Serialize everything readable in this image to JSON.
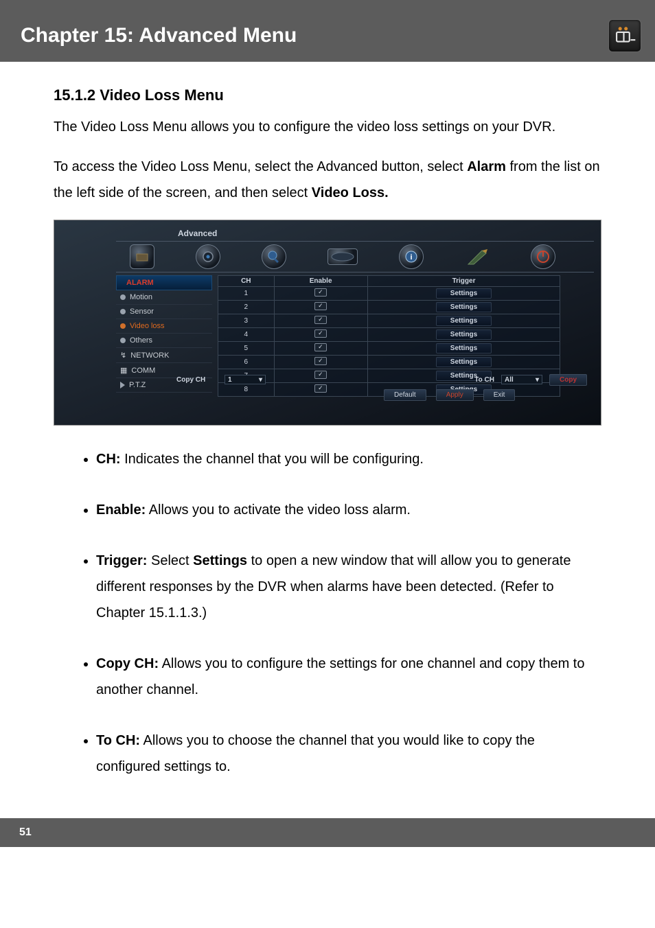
{
  "header": {
    "chapter_title": "Chapter 15: Advanced Menu"
  },
  "section": {
    "heading": "15.1.2 Video Loss Menu",
    "intro": "The Video Loss Menu allows you to configure the video loss settings on your DVR.",
    "access_pre": "To access the Video Loss Menu, select the Advanced button, select ",
    "access_b1": "Alarm",
    "access_mid": " from the list on the left side of the screen, and then select ",
    "access_b2": "Video Loss."
  },
  "shot": {
    "window_title": "Advanced",
    "sidebar_header": "ALARM",
    "sidebar": [
      "Motion",
      "Sensor",
      "Video loss",
      "Others",
      "NETWORK",
      "COMM",
      "P.T.Z"
    ],
    "columns": {
      "ch": "CH",
      "enable": "Enable",
      "trigger": "Trigger"
    },
    "rows": [
      {
        "ch": "1",
        "trigger": "Settings"
      },
      {
        "ch": "2",
        "trigger": "Settings"
      },
      {
        "ch": "3",
        "trigger": "Settings"
      },
      {
        "ch": "4",
        "trigger": "Settings"
      },
      {
        "ch": "5",
        "trigger": "Settings"
      },
      {
        "ch": "6",
        "trigger": "Settings"
      },
      {
        "ch": "7",
        "trigger": "Settings"
      },
      {
        "ch": "8",
        "trigger": "Settings"
      }
    ],
    "copy_label": "Copy CH",
    "copy_value": "1",
    "toch_label": "To CH",
    "toch_value": "All",
    "btn_copy": "Copy",
    "btn_default": "Default",
    "btn_apply": "Apply",
    "btn_exit": "Exit"
  },
  "bullets": {
    "ch_l": "CH:",
    "ch_t": " Indicates the channel that you will be configuring.",
    "en_l": "Enable:",
    "en_t": " Allows you to activate the video loss alarm.",
    "tr_l": "Trigger:",
    "tr_t1": " Select ",
    "tr_b": "Settings",
    "tr_t2": " to open a new window that will allow you to generate different responses by the DVR when alarms have been detected. (Refer to Chapter 15.1.1.3.)",
    "cc_l": "Copy CH:",
    "cc_t": " Allows you to configure the settings for one channel and copy them to another channel.",
    "tc_l": "To CH:",
    "tc_t": " Allows you to choose the channel that you would like to copy the configured settings to."
  },
  "footer": {
    "page": "51"
  }
}
